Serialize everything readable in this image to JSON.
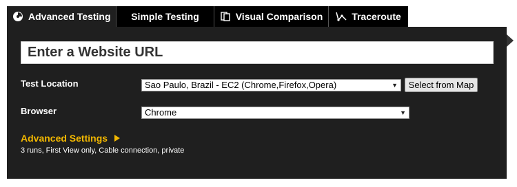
{
  "tabs": [
    {
      "label": "Advanced Testing",
      "icon": "gauge-icon",
      "active": true
    },
    {
      "label": "Simple Testing",
      "active": false
    },
    {
      "label": "Visual Comparison",
      "icon": "document-compare-icon",
      "active": false
    },
    {
      "label": "Traceroute",
      "icon": "route-graph-icon",
      "active": false
    }
  ],
  "url": {
    "placeholder": "Enter a Website URL"
  },
  "test_location": {
    "label": "Test Location",
    "value": "Sao Paulo, Brazil - EC2 (Chrome,Firefox,Opera)",
    "button": "Select from Map"
  },
  "browser": {
    "label": "Browser",
    "value": "Chrome"
  },
  "advanced": {
    "label": "Advanced Settings",
    "summary": "3 runs, First View only, Cable connection, private"
  },
  "colors": {
    "panel": "#1f1f1f",
    "accent": "#f2b700",
    "tab_inactive": "#000000"
  }
}
